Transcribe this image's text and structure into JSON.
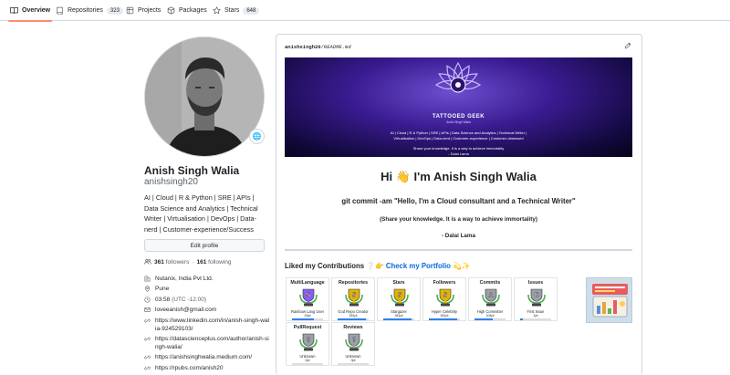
{
  "tabs": [
    {
      "label": "Overview",
      "count": null,
      "active": true,
      "icon": "book-icon"
    },
    {
      "label": "Repositories",
      "count": "323",
      "active": false,
      "icon": "repo-icon"
    },
    {
      "label": "Projects",
      "count": null,
      "active": false,
      "icon": "project-icon"
    },
    {
      "label": "Packages",
      "count": null,
      "active": false,
      "icon": "package-icon"
    },
    {
      "label": "Stars",
      "count": "648",
      "active": false,
      "icon": "star-icon"
    }
  ],
  "profile": {
    "status_emoji": "🌐",
    "name": "Anish Singh Walia",
    "login": "anishsingh20",
    "bio": "AI | Cloud | R & Python | SRE | APIs | Data Science and Analytics | Technical Writer | Virtualisation | DevOps | Data-nerd | Customer-experience/Success",
    "edit_label": "Edit profile",
    "followers_count": "361",
    "followers_label": "followers",
    "separator": "·",
    "following_count": "161",
    "following_label": "following",
    "details": [
      {
        "icon": "organization-icon",
        "text": "Nutanix, India Pvt Ltd."
      },
      {
        "icon": "location-icon",
        "text": "Pune"
      },
      {
        "icon": "clock-icon",
        "text": "03:58",
        "extra": "(UTC -12:00)"
      },
      {
        "icon": "mail-icon",
        "text": "loveeanish@gmail.com"
      },
      {
        "icon": "link-icon",
        "text": "https://www.linkedin.com/in/anish-singh-walia-924529103/"
      },
      {
        "icon": "link-icon",
        "text": "https://datascienceplus.com/author/anish-singh-walia/"
      },
      {
        "icon": "link-icon",
        "text": "https://anishsinghwalia.medium.com/"
      },
      {
        "icon": "link-icon",
        "text": "https://rpubs.com/anish20"
      }
    ]
  },
  "readme": {
    "path_user": "anishsingh20",
    "path_sep": "/",
    "path_file": "README.md",
    "banner": {
      "brand": "TATTOOED GEEK",
      "brand_sub": "Anish Singh Walia",
      "line1": "AI | Cloud | R & Python | SRE | APIs | Data Science and Analytics | Technical Writer |",
      "line2": "Virtualisation | DevOps | Data-nerd | Customer-experience | Customer-obsessed",
      "line3": "Share your knowledge. It is a way to achieve immortality",
      "line4": "- Dalai Lama"
    },
    "greeting": "Hi 👋 I'm Anish Singh Walia",
    "tagline": "git commit -am \"Hello, I'm a Cloud consultant and a Technical Writer\"",
    "quote": "(Share your knowledge. It is a way to achieve immortality)",
    "quote_author": "- Dalai Lama",
    "liked_prefix": "Liked my Contributions ❔👉",
    "liked_link": "Check my Portfolio",
    "liked_suffix": "💫✨",
    "trophies": [
      {
        "title": "MultiLanguage",
        "rank": "S",
        "name": "Rainbow Lang User",
        "points": "20pt",
        "progress": 0.7,
        "color": "#8a5cf6"
      },
      {
        "title": "Repositories",
        "rank": "S",
        "name": "God Repo Creator",
        "points": "281pt",
        "progress": 0.9,
        "color": "#e0b400"
      },
      {
        "title": "Stars",
        "rank": "S",
        "name": "Stargazer",
        "points": "361pt",
        "progress": 0.9,
        "color": "#e0b400"
      },
      {
        "title": "Followers",
        "rank": "S",
        "name": "Hyper Celebrity",
        "points": "361pt",
        "progress": 0.9,
        "color": "#e0b400"
      },
      {
        "title": "Commits",
        "rank": "A",
        "name": "High Committer",
        "points": "104pt",
        "progress": 0.6,
        "color": "#9aa0a6"
      },
      {
        "title": "Issues",
        "rank": "C",
        "name": "First Issue",
        "points": "1pt",
        "progress": 0.1,
        "color": "#9aa0a6"
      },
      {
        "title": "PullRequest",
        "rank": "?",
        "name": "Unknown",
        "points": "0pt",
        "progress": 0,
        "color": "#9aa0a6"
      },
      {
        "title": "Reviews",
        "rank": "?",
        "name": "Unknown",
        "points": "0pt",
        "progress": 0,
        "color": "#9aa0a6"
      }
    ]
  },
  "colors": {
    "link": "#0969da",
    "tab_underline": "#fd8c73",
    "border": "#d0d7de",
    "muted": "#59636e"
  }
}
